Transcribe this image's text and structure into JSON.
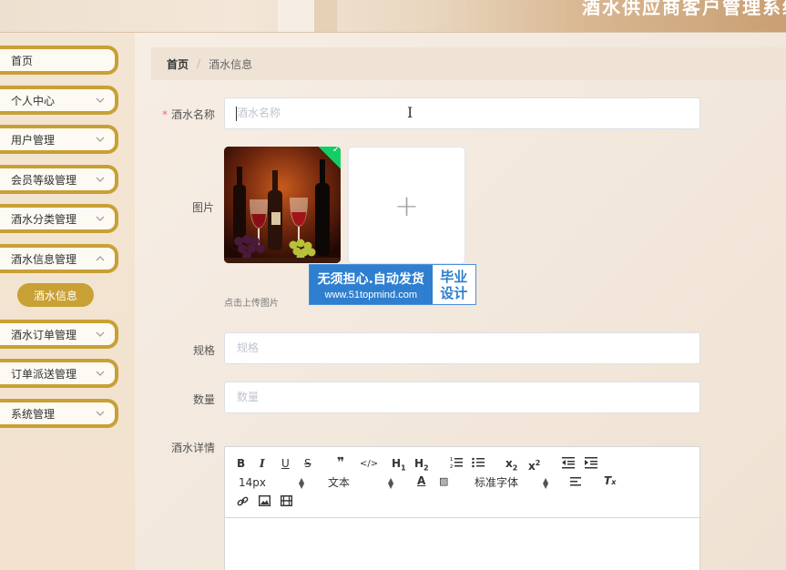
{
  "header": {
    "title": "酒水供应商客户管理系统"
  },
  "sidebar": {
    "items": [
      {
        "label": "首页",
        "has_chevron": false
      },
      {
        "label": "个人中心",
        "has_chevron": true
      },
      {
        "label": "用户管理",
        "has_chevron": true
      },
      {
        "label": "会员等级管理",
        "has_chevron": true
      },
      {
        "label": "酒水分类管理",
        "has_chevron": true
      },
      {
        "label": "酒水信息管理",
        "has_chevron": true
      },
      {
        "label": "酒水订单管理",
        "has_chevron": true
      },
      {
        "label": "订单派送管理",
        "has_chevron": true
      },
      {
        "label": "系统管理",
        "has_chevron": true
      }
    ],
    "active_sub_item": "酒水信息"
  },
  "breadcrumb": {
    "home": "首页",
    "separator": "/",
    "current": "酒水信息"
  },
  "form": {
    "name_label": "酒水名称",
    "name_placeholder": "酒水名称",
    "image_label": "图片",
    "upload_hint": "点击上传图片",
    "spec_label": "规格",
    "spec_placeholder": "规格",
    "qty_label": "数量",
    "qty_placeholder": "数量",
    "detail_label": "酒水详情"
  },
  "editor": {
    "font_size": "14px",
    "text_type": "文本",
    "font_family": "标准字体"
  },
  "watermark": {
    "line1": "无须担心.自动发货",
    "line2": "www.51topmind.com",
    "badge1": "毕业",
    "badge2": "设计"
  },
  "colors": {
    "accent": "#c8a034",
    "required": "#f56c6c",
    "success": "#13ce66"
  }
}
